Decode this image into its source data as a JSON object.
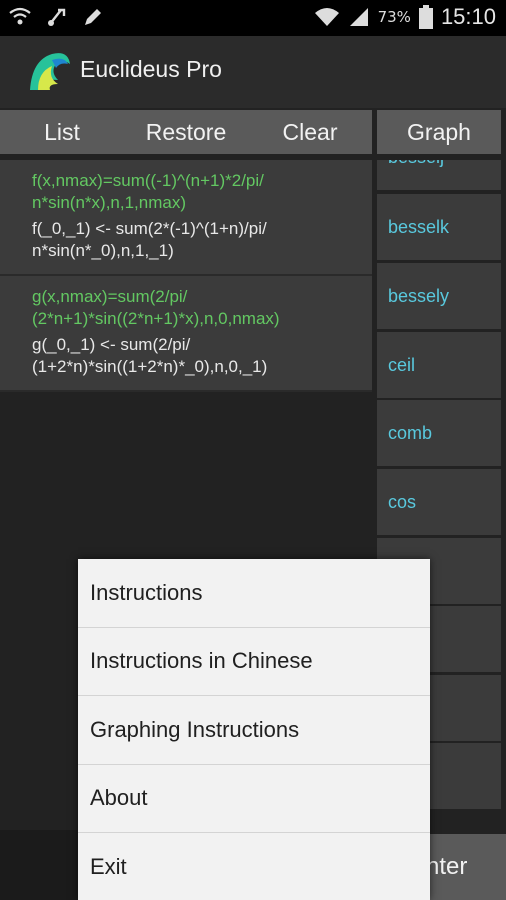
{
  "status_bar": {
    "battery_percent": "73%",
    "time": "15:10",
    "left_icons": [
      "wifi-share-icon",
      "usb-icon",
      "pen-icon"
    ],
    "right_icons": [
      "wifi-icon",
      "signal-icon",
      "battery-icon"
    ]
  },
  "app": {
    "title": "Euclideus Pro",
    "icon": "wave-logo-icon"
  },
  "toolbar": {
    "list_label": "List",
    "restore_label": "Restore",
    "clear_label": "Clear",
    "graph_label": "Graph"
  },
  "expressions": [
    {
      "definition": "f(x,nmax)=sum((-1)^(n+1)*2/pi/\nn*sin(n*x),n,1,nmax)",
      "result": "f(_0,_1) <- sum(2*(-1)^(1+n)/pi/\nn*sin(n*_0),n,1,_1)"
    },
    {
      "definition": "g(x,nmax)=sum(2/pi/\n(2*n+1)*sin((2*n+1)*x),n,0,nmax)",
      "result": "g(_0,_1) <- sum(2/pi/\n(1+2*n)*sin((1+2*n)*_0),n,0,_1)"
    }
  ],
  "functions": [
    "besselj",
    "besselk",
    "bessely",
    "ceil",
    "comb",
    "cos"
  ],
  "bottom": {
    "enter_label": "nter"
  },
  "menu": {
    "items": [
      "Instructions",
      "Instructions in Chinese",
      "Graphing Instructions",
      "About",
      "Exit"
    ]
  },
  "colors": {
    "definition_green": "#63c862",
    "function_cyan": "#59c9de",
    "panel_gray": "#3b3b3b",
    "button_gray": "#5a5a5a"
  }
}
